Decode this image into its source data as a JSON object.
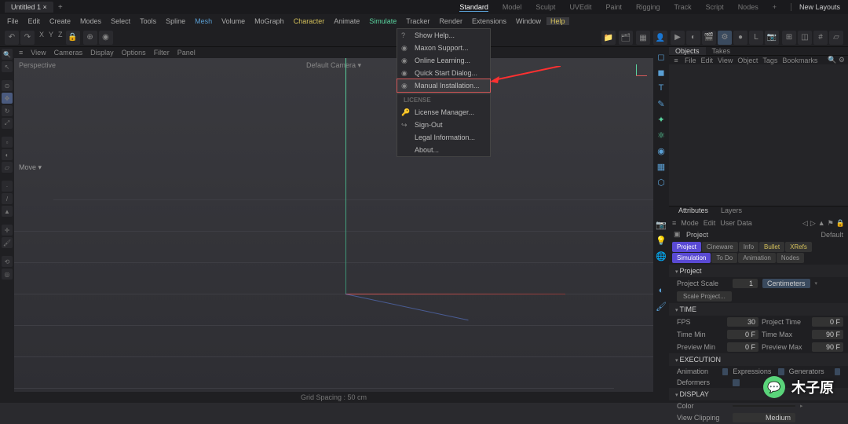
{
  "titlebar": {
    "tab": "Untitled 1",
    "close": "×",
    "plus": "+"
  },
  "layouts": {
    "items": [
      "Standard",
      "Model",
      "Sculpt",
      "UVEdit",
      "Paint",
      "Rigging",
      "Track",
      "Script",
      "Nodes"
    ],
    "plus": "+",
    "new": "New Layouts"
  },
  "menu": [
    "File",
    "Edit",
    "Create",
    "Modes",
    "Select",
    "Tools",
    "Spline",
    "Mesh",
    "Volume",
    "MoGraph",
    "Character",
    "Animate",
    "Simulate",
    "Tracker",
    "Render",
    "Extensions",
    "Window",
    "Help"
  ],
  "coords": [
    "X",
    "Y",
    "Z"
  ],
  "vp_menu": [
    "View",
    "Cameras",
    "Display",
    "Options",
    "Filter",
    "Panel"
  ],
  "vp": {
    "persp": "Perspective",
    "camera": "Default Camera ▾",
    "status": "Grid Spacing : 50 cm",
    "move": "Move ▾"
  },
  "help": {
    "items": [
      "Show Help...",
      "Maxon Support...",
      "Online Learning...",
      "Quick Start Dialog...",
      "Manual Installation..."
    ],
    "section": "LICENSE",
    "lic": [
      "License Manager...",
      "Sign-Out",
      "Legal Information...",
      "About..."
    ]
  },
  "obj": {
    "tabs": [
      "Objects",
      "Takes"
    ],
    "menu": [
      "File",
      "Edit",
      "View",
      "Object",
      "Tags",
      "Bookmarks"
    ]
  },
  "attr": {
    "tabs": [
      "Attributes",
      "Layers"
    ],
    "menu": [
      "Mode",
      "Edit",
      "User Data"
    ],
    "project": "Project",
    "default": "Default",
    "tabbtns": [
      "Project",
      "Cineware",
      "Info",
      "Bullet",
      "XRefs",
      "Simulation",
      "To Do",
      "Animation",
      "Nodes"
    ],
    "sec_project": "Project",
    "scale": {
      "label": "Project Scale",
      "val": "1",
      "unit": "Centimeters"
    },
    "scalebtn": "Scale Project...",
    "sec_time": "TIME",
    "fps": {
      "l": "FPS",
      "v": "30"
    },
    "ptime": {
      "l": "Project Time",
      "v": "0 F"
    },
    "tmin": {
      "l": "Time Min",
      "v": "0 F"
    },
    "tmax": {
      "l": "Time Max",
      "v": "90 F"
    },
    "pmin": {
      "l": "Preview Min",
      "v": "0 F"
    },
    "pmax": {
      "l": "Preview Max",
      "v": "90 F"
    },
    "sec_exec": "EXECUTION",
    "anim": "Animation",
    "expr": "Expressions",
    "gen": "Generators",
    "def": "Deformers",
    "sec_disp": "DISPLAY",
    "color": {
      "l": "Color",
      "v": ""
    },
    "vclip": {
      "l": "View Clipping",
      "v": "Medium"
    }
  },
  "watermark": "木子原"
}
